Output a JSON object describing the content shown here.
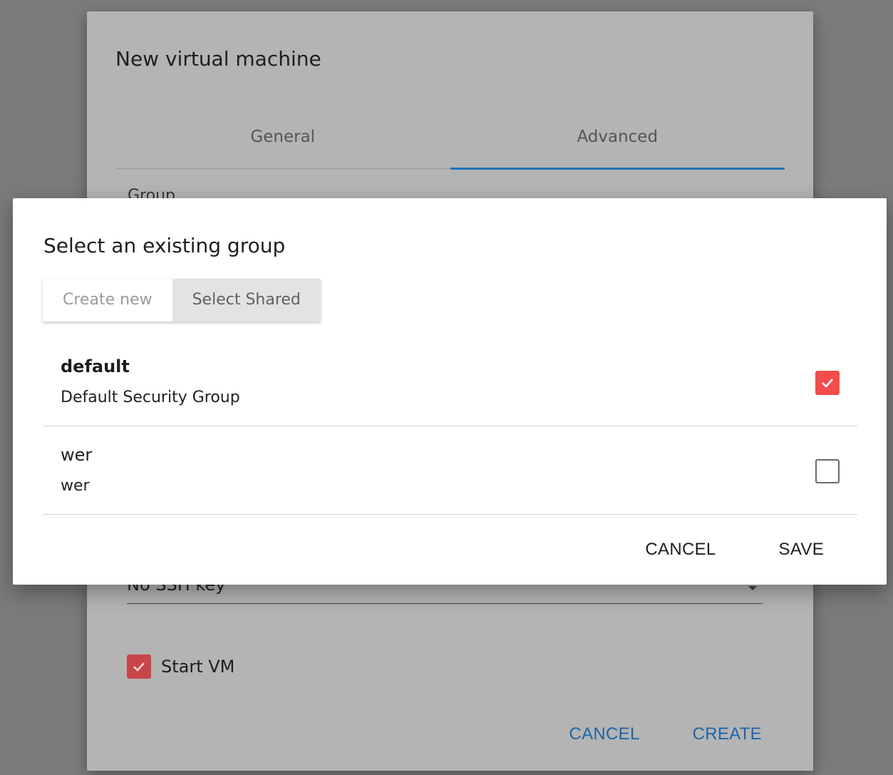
{
  "background_dialog": {
    "title": "New virtual machine",
    "tabs": [
      {
        "label": "General",
        "active": false
      },
      {
        "label": "Advanced",
        "active": true
      }
    ],
    "group_label": "Group",
    "ssh_select": {
      "value": "No SSH key"
    },
    "start_vm": {
      "label": "Start VM",
      "checked": true
    },
    "actions": {
      "cancel": "CANCEL",
      "create": "CREATE"
    }
  },
  "modal": {
    "title": "Select an existing group",
    "toggle": {
      "create_new": "Create new",
      "select_shared": "Select Shared",
      "active": "Select Shared"
    },
    "groups": [
      {
        "name": "default",
        "description": "Default Security Group",
        "checked": true
      },
      {
        "name": "wer",
        "description": "wer",
        "checked": false
      }
    ],
    "actions": {
      "cancel": "CANCEL",
      "save": "SAVE"
    }
  },
  "colors": {
    "overlay": "#7b7b7b",
    "accent_blue": "#1f73b7",
    "checkbox_red": "#f44b4b",
    "toggle_active_bg": "#e3e3e3"
  }
}
